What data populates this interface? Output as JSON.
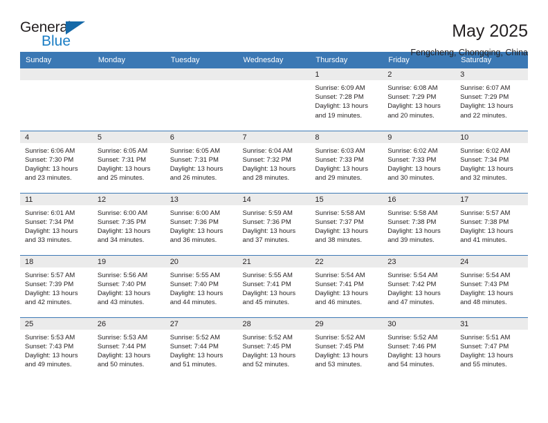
{
  "brand": {
    "name_top": "General",
    "name_bottom": "Blue",
    "accent_color": "#1a7dc4",
    "triangle_color": "#1569a8"
  },
  "header": {
    "title": "May 2025",
    "subtitle": "Fengcheng, Chongqing, China"
  },
  "theme": {
    "header_bar_color": "#3b78b4",
    "daynum_band_color": "#ebebeb",
    "text_color": "#231f20"
  },
  "weekday_headers": [
    "Sunday",
    "Monday",
    "Tuesday",
    "Wednesday",
    "Thursday",
    "Friday",
    "Saturday"
  ],
  "weeks": [
    [
      {
        "day": "",
        "empty": true,
        "sunrise": "",
        "sunset": "",
        "daylight_1": "",
        "daylight_2": ""
      },
      {
        "day": "",
        "empty": true,
        "sunrise": "",
        "sunset": "",
        "daylight_1": "",
        "daylight_2": ""
      },
      {
        "day": "",
        "empty": true,
        "sunrise": "",
        "sunset": "",
        "daylight_1": "",
        "daylight_2": ""
      },
      {
        "day": "",
        "empty": true,
        "sunrise": "",
        "sunset": "",
        "daylight_1": "",
        "daylight_2": ""
      },
      {
        "day": "1",
        "empty": false,
        "sunrise": "Sunrise: 6:09 AM",
        "sunset": "Sunset: 7:28 PM",
        "daylight_1": "Daylight: 13 hours",
        "daylight_2": "and 19 minutes."
      },
      {
        "day": "2",
        "empty": false,
        "sunrise": "Sunrise: 6:08 AM",
        "sunset": "Sunset: 7:29 PM",
        "daylight_1": "Daylight: 13 hours",
        "daylight_2": "and 20 minutes."
      },
      {
        "day": "3",
        "empty": false,
        "sunrise": "Sunrise: 6:07 AM",
        "sunset": "Sunset: 7:29 PM",
        "daylight_1": "Daylight: 13 hours",
        "daylight_2": "and 22 minutes."
      }
    ],
    [
      {
        "day": "4",
        "empty": false,
        "sunrise": "Sunrise: 6:06 AM",
        "sunset": "Sunset: 7:30 PM",
        "daylight_1": "Daylight: 13 hours",
        "daylight_2": "and 23 minutes."
      },
      {
        "day": "5",
        "empty": false,
        "sunrise": "Sunrise: 6:05 AM",
        "sunset": "Sunset: 7:31 PM",
        "daylight_1": "Daylight: 13 hours",
        "daylight_2": "and 25 minutes."
      },
      {
        "day": "6",
        "empty": false,
        "sunrise": "Sunrise: 6:05 AM",
        "sunset": "Sunset: 7:31 PM",
        "daylight_1": "Daylight: 13 hours",
        "daylight_2": "and 26 minutes."
      },
      {
        "day": "7",
        "empty": false,
        "sunrise": "Sunrise: 6:04 AM",
        "sunset": "Sunset: 7:32 PM",
        "daylight_1": "Daylight: 13 hours",
        "daylight_2": "and 28 minutes."
      },
      {
        "day": "8",
        "empty": false,
        "sunrise": "Sunrise: 6:03 AM",
        "sunset": "Sunset: 7:33 PM",
        "daylight_1": "Daylight: 13 hours",
        "daylight_2": "and 29 minutes."
      },
      {
        "day": "9",
        "empty": false,
        "sunrise": "Sunrise: 6:02 AM",
        "sunset": "Sunset: 7:33 PM",
        "daylight_1": "Daylight: 13 hours",
        "daylight_2": "and 30 minutes."
      },
      {
        "day": "10",
        "empty": false,
        "sunrise": "Sunrise: 6:02 AM",
        "sunset": "Sunset: 7:34 PM",
        "daylight_1": "Daylight: 13 hours",
        "daylight_2": "and 32 minutes."
      }
    ],
    [
      {
        "day": "11",
        "empty": false,
        "sunrise": "Sunrise: 6:01 AM",
        "sunset": "Sunset: 7:34 PM",
        "daylight_1": "Daylight: 13 hours",
        "daylight_2": "and 33 minutes."
      },
      {
        "day": "12",
        "empty": false,
        "sunrise": "Sunrise: 6:00 AM",
        "sunset": "Sunset: 7:35 PM",
        "daylight_1": "Daylight: 13 hours",
        "daylight_2": "and 34 minutes."
      },
      {
        "day": "13",
        "empty": false,
        "sunrise": "Sunrise: 6:00 AM",
        "sunset": "Sunset: 7:36 PM",
        "daylight_1": "Daylight: 13 hours",
        "daylight_2": "and 36 minutes."
      },
      {
        "day": "14",
        "empty": false,
        "sunrise": "Sunrise: 5:59 AM",
        "sunset": "Sunset: 7:36 PM",
        "daylight_1": "Daylight: 13 hours",
        "daylight_2": "and 37 minutes."
      },
      {
        "day": "15",
        "empty": false,
        "sunrise": "Sunrise: 5:58 AM",
        "sunset": "Sunset: 7:37 PM",
        "daylight_1": "Daylight: 13 hours",
        "daylight_2": "and 38 minutes."
      },
      {
        "day": "16",
        "empty": false,
        "sunrise": "Sunrise: 5:58 AM",
        "sunset": "Sunset: 7:38 PM",
        "daylight_1": "Daylight: 13 hours",
        "daylight_2": "and 39 minutes."
      },
      {
        "day": "17",
        "empty": false,
        "sunrise": "Sunrise: 5:57 AM",
        "sunset": "Sunset: 7:38 PM",
        "daylight_1": "Daylight: 13 hours",
        "daylight_2": "and 41 minutes."
      }
    ],
    [
      {
        "day": "18",
        "empty": false,
        "sunrise": "Sunrise: 5:57 AM",
        "sunset": "Sunset: 7:39 PM",
        "daylight_1": "Daylight: 13 hours",
        "daylight_2": "and 42 minutes."
      },
      {
        "day": "19",
        "empty": false,
        "sunrise": "Sunrise: 5:56 AM",
        "sunset": "Sunset: 7:40 PM",
        "daylight_1": "Daylight: 13 hours",
        "daylight_2": "and 43 minutes."
      },
      {
        "day": "20",
        "empty": false,
        "sunrise": "Sunrise: 5:55 AM",
        "sunset": "Sunset: 7:40 PM",
        "daylight_1": "Daylight: 13 hours",
        "daylight_2": "and 44 minutes."
      },
      {
        "day": "21",
        "empty": false,
        "sunrise": "Sunrise: 5:55 AM",
        "sunset": "Sunset: 7:41 PM",
        "daylight_1": "Daylight: 13 hours",
        "daylight_2": "and 45 minutes."
      },
      {
        "day": "22",
        "empty": false,
        "sunrise": "Sunrise: 5:54 AM",
        "sunset": "Sunset: 7:41 PM",
        "daylight_1": "Daylight: 13 hours",
        "daylight_2": "and 46 minutes."
      },
      {
        "day": "23",
        "empty": false,
        "sunrise": "Sunrise: 5:54 AM",
        "sunset": "Sunset: 7:42 PM",
        "daylight_1": "Daylight: 13 hours",
        "daylight_2": "and 47 minutes."
      },
      {
        "day": "24",
        "empty": false,
        "sunrise": "Sunrise: 5:54 AM",
        "sunset": "Sunset: 7:43 PM",
        "daylight_1": "Daylight: 13 hours",
        "daylight_2": "and 48 minutes."
      }
    ],
    [
      {
        "day": "25",
        "empty": false,
        "sunrise": "Sunrise: 5:53 AM",
        "sunset": "Sunset: 7:43 PM",
        "daylight_1": "Daylight: 13 hours",
        "daylight_2": "and 49 minutes."
      },
      {
        "day": "26",
        "empty": false,
        "sunrise": "Sunrise: 5:53 AM",
        "sunset": "Sunset: 7:44 PM",
        "daylight_1": "Daylight: 13 hours",
        "daylight_2": "and 50 minutes."
      },
      {
        "day": "27",
        "empty": false,
        "sunrise": "Sunrise: 5:52 AM",
        "sunset": "Sunset: 7:44 PM",
        "daylight_1": "Daylight: 13 hours",
        "daylight_2": "and 51 minutes."
      },
      {
        "day": "28",
        "empty": false,
        "sunrise": "Sunrise: 5:52 AM",
        "sunset": "Sunset: 7:45 PM",
        "daylight_1": "Daylight: 13 hours",
        "daylight_2": "and 52 minutes."
      },
      {
        "day": "29",
        "empty": false,
        "sunrise": "Sunrise: 5:52 AM",
        "sunset": "Sunset: 7:45 PM",
        "daylight_1": "Daylight: 13 hours",
        "daylight_2": "and 53 minutes."
      },
      {
        "day": "30",
        "empty": false,
        "sunrise": "Sunrise: 5:52 AM",
        "sunset": "Sunset: 7:46 PM",
        "daylight_1": "Daylight: 13 hours",
        "daylight_2": "and 54 minutes."
      },
      {
        "day": "31",
        "empty": false,
        "sunrise": "Sunrise: 5:51 AM",
        "sunset": "Sunset: 7:47 PM",
        "daylight_1": "Daylight: 13 hours",
        "daylight_2": "and 55 minutes."
      }
    ]
  ]
}
